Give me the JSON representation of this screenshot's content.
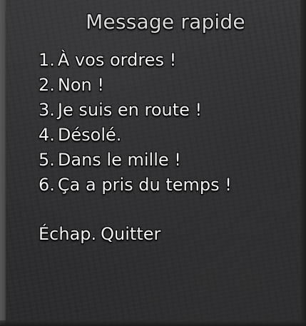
{
  "title": "Message rapide",
  "messages": [
    {
      "key": "1.",
      "text": "À vos ordres !"
    },
    {
      "key": "2.",
      "text": "Non !"
    },
    {
      "key": "3.",
      "text": "Je suis en route !"
    },
    {
      "key": "4.",
      "text": "Désolé."
    },
    {
      "key": "5.",
      "text": "Dans le mille !"
    },
    {
      "key": "6.",
      "text": "Ça a pris du temps !"
    }
  ],
  "quit": {
    "key": "Échap.",
    "text": "Quitter"
  },
  "colors": {
    "title_text": "#dcdcdc",
    "item_text": "#f2f2f2",
    "outline": "#000000",
    "panel_overlay": "#202022"
  }
}
